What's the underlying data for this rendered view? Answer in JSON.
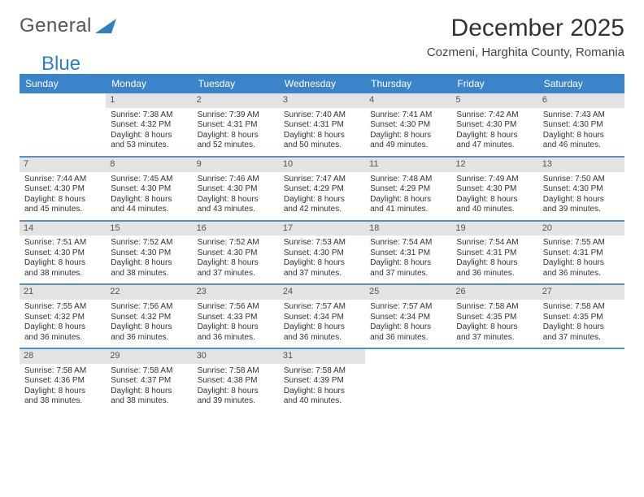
{
  "brand": {
    "word1": "General",
    "word2": "Blue"
  },
  "title": "December 2025",
  "location": "Cozmeni, Harghita County, Romania",
  "daynames": [
    "Sunday",
    "Monday",
    "Tuesday",
    "Wednesday",
    "Thursday",
    "Friday",
    "Saturday"
  ],
  "chart_data": {
    "type": "table",
    "title": "Sunrise / Sunset / Daylight — December 2025, Cozmeni, Harghita County, Romania",
    "columns": [
      "date",
      "sunrise",
      "sunset",
      "daylight"
    ],
    "rows": [
      {
        "date": "2025-12-01",
        "sunrise": "7:38 AM",
        "sunset": "4:32 PM",
        "daylight": "8 hours and 53 minutes."
      },
      {
        "date": "2025-12-02",
        "sunrise": "7:39 AM",
        "sunset": "4:31 PM",
        "daylight": "8 hours and 52 minutes."
      },
      {
        "date": "2025-12-03",
        "sunrise": "7:40 AM",
        "sunset": "4:31 PM",
        "daylight": "8 hours and 50 minutes."
      },
      {
        "date": "2025-12-04",
        "sunrise": "7:41 AM",
        "sunset": "4:30 PM",
        "daylight": "8 hours and 49 minutes."
      },
      {
        "date": "2025-12-05",
        "sunrise": "7:42 AM",
        "sunset": "4:30 PM",
        "daylight": "8 hours and 47 minutes."
      },
      {
        "date": "2025-12-06",
        "sunrise": "7:43 AM",
        "sunset": "4:30 PM",
        "daylight": "8 hours and 46 minutes."
      },
      {
        "date": "2025-12-07",
        "sunrise": "7:44 AM",
        "sunset": "4:30 PM",
        "daylight": "8 hours and 45 minutes."
      },
      {
        "date": "2025-12-08",
        "sunrise": "7:45 AM",
        "sunset": "4:30 PM",
        "daylight": "8 hours and 44 minutes."
      },
      {
        "date": "2025-12-09",
        "sunrise": "7:46 AM",
        "sunset": "4:30 PM",
        "daylight": "8 hours and 43 minutes."
      },
      {
        "date": "2025-12-10",
        "sunrise": "7:47 AM",
        "sunset": "4:29 PM",
        "daylight": "8 hours and 42 minutes."
      },
      {
        "date": "2025-12-11",
        "sunrise": "7:48 AM",
        "sunset": "4:29 PM",
        "daylight": "8 hours and 41 minutes."
      },
      {
        "date": "2025-12-12",
        "sunrise": "7:49 AM",
        "sunset": "4:30 PM",
        "daylight": "8 hours and 40 minutes."
      },
      {
        "date": "2025-12-13",
        "sunrise": "7:50 AM",
        "sunset": "4:30 PM",
        "daylight": "8 hours and 39 minutes."
      },
      {
        "date": "2025-12-14",
        "sunrise": "7:51 AM",
        "sunset": "4:30 PM",
        "daylight": "8 hours and 38 minutes."
      },
      {
        "date": "2025-12-15",
        "sunrise": "7:52 AM",
        "sunset": "4:30 PM",
        "daylight": "8 hours and 38 minutes."
      },
      {
        "date": "2025-12-16",
        "sunrise": "7:52 AM",
        "sunset": "4:30 PM",
        "daylight": "8 hours and 37 minutes."
      },
      {
        "date": "2025-12-17",
        "sunrise": "7:53 AM",
        "sunset": "4:30 PM",
        "daylight": "8 hours and 37 minutes."
      },
      {
        "date": "2025-12-18",
        "sunrise": "7:54 AM",
        "sunset": "4:31 PM",
        "daylight": "8 hours and 37 minutes."
      },
      {
        "date": "2025-12-19",
        "sunrise": "7:54 AM",
        "sunset": "4:31 PM",
        "daylight": "8 hours and 36 minutes."
      },
      {
        "date": "2025-12-20",
        "sunrise": "7:55 AM",
        "sunset": "4:31 PM",
        "daylight": "8 hours and 36 minutes."
      },
      {
        "date": "2025-12-21",
        "sunrise": "7:55 AM",
        "sunset": "4:32 PM",
        "daylight": "8 hours and 36 minutes."
      },
      {
        "date": "2025-12-22",
        "sunrise": "7:56 AM",
        "sunset": "4:32 PM",
        "daylight": "8 hours and 36 minutes."
      },
      {
        "date": "2025-12-23",
        "sunrise": "7:56 AM",
        "sunset": "4:33 PM",
        "daylight": "8 hours and 36 minutes."
      },
      {
        "date": "2025-12-24",
        "sunrise": "7:57 AM",
        "sunset": "4:34 PM",
        "daylight": "8 hours and 36 minutes."
      },
      {
        "date": "2025-12-25",
        "sunrise": "7:57 AM",
        "sunset": "4:34 PM",
        "daylight": "8 hours and 36 minutes."
      },
      {
        "date": "2025-12-26",
        "sunrise": "7:58 AM",
        "sunset": "4:35 PM",
        "daylight": "8 hours and 37 minutes."
      },
      {
        "date": "2025-12-27",
        "sunrise": "7:58 AM",
        "sunset": "4:35 PM",
        "daylight": "8 hours and 37 minutes."
      },
      {
        "date": "2025-12-28",
        "sunrise": "7:58 AM",
        "sunset": "4:36 PM",
        "daylight": "8 hours and 38 minutes."
      },
      {
        "date": "2025-12-29",
        "sunrise": "7:58 AM",
        "sunset": "4:37 PM",
        "daylight": "8 hours and 38 minutes."
      },
      {
        "date": "2025-12-30",
        "sunrise": "7:58 AM",
        "sunset": "4:38 PM",
        "daylight": "8 hours and 39 minutes."
      },
      {
        "date": "2025-12-31",
        "sunrise": "7:58 AM",
        "sunset": "4:39 PM",
        "daylight": "8 hours and 40 minutes."
      }
    ]
  },
  "labels": {
    "sunrise": "Sunrise:",
    "sunset": "Sunset:",
    "daylight": "Daylight:"
  },
  "first_weekday_index": 1
}
